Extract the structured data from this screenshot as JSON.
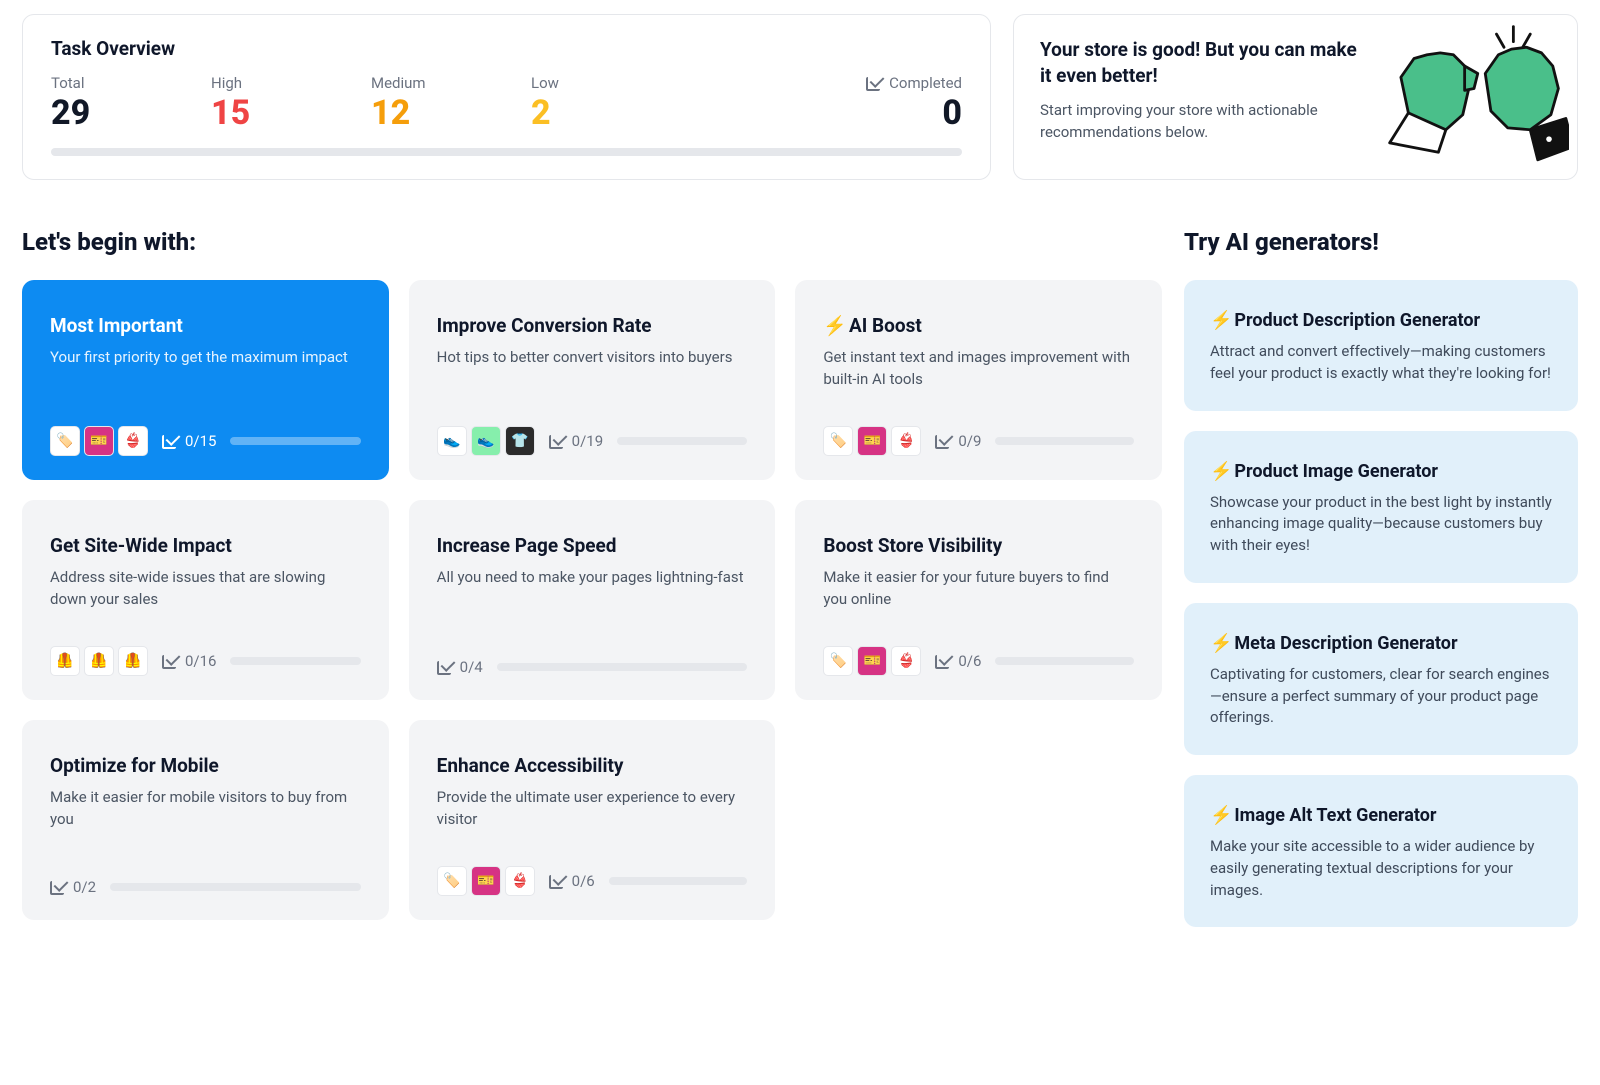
{
  "overview": {
    "title": "Task Overview",
    "total_label": "Total",
    "total_value": "29",
    "high_label": "High",
    "high_value": "15",
    "medium_label": "Medium",
    "medium_value": "12",
    "low_label": "Low",
    "low_value": "2",
    "completed_label": "Completed",
    "completed_value": "0"
  },
  "tip": {
    "title": "Your store is good! But you can make it even better!",
    "desc": "Start improving your store with actionable recommendations below."
  },
  "begin": {
    "heading": "Let's begin with:",
    "tiles": [
      {
        "title": "Most Important",
        "desc": "Your first priority to get the maximum impact",
        "count": "0/15",
        "bolt": false
      },
      {
        "title": "Improve Conversion Rate",
        "desc": "Hot tips to better convert visitors into buyers",
        "count": "0/19",
        "bolt": false
      },
      {
        "title": "AI Boost",
        "desc": "Get instant text and images improvement with built-in AI tools",
        "count": "0/9",
        "bolt": true
      },
      {
        "title": "Get Site-Wide Impact",
        "desc": "Address site-wide issues that are slowing down your sales",
        "count": "0/16",
        "bolt": false
      },
      {
        "title": "Increase Page Speed",
        "desc": "All you need to make your pages lightning-fast",
        "count": "0/4",
        "bolt": false
      },
      {
        "title": "Boost Store Visibility",
        "desc": "Make it easier for your future buyers to find you online",
        "count": "0/6",
        "bolt": false
      },
      {
        "title": "Optimize for Mobile",
        "desc": "Make it easier for mobile visitors to buy from you",
        "count": "0/2",
        "bolt": false
      },
      {
        "title": "Enhance Accessibility",
        "desc": "Provide the ultimate user experience to every visitor",
        "count": "0/6",
        "bolt": false
      }
    ]
  },
  "ai": {
    "heading": "Try AI generators!",
    "tiles": [
      {
        "title": "Product Description Generator",
        "desc": "Attract and convert effectively—making customers feel your product is exactly what they're looking for!"
      },
      {
        "title": "Product Image Generator",
        "desc": "Showcase your product in the best light by instantly enhancing image quality—because customers buy with their eyes!"
      },
      {
        "title": "Meta Description Generator",
        "desc": "Captivating for customers, clear for search engines—ensure a perfect summary of your product page offerings."
      },
      {
        "title": "Image Alt Text Generator",
        "desc": "Make your site accessible to a wider audience by easily generating textual descriptions for your images."
      }
    ]
  }
}
